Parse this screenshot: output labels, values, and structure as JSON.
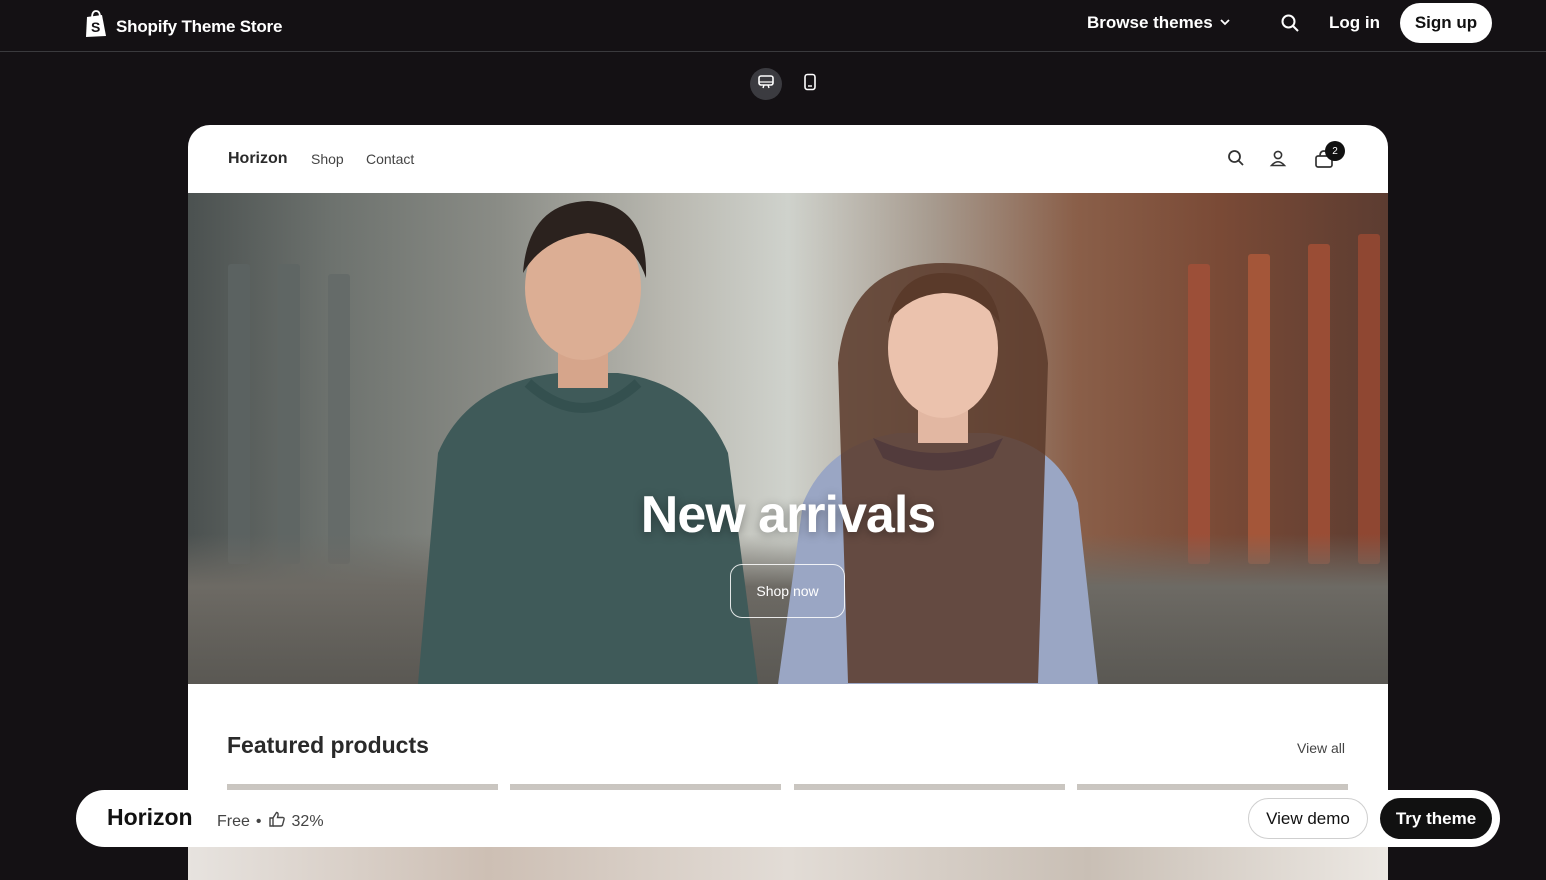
{
  "topbar": {
    "brand_title": "Shopify Theme Store",
    "browse_label": "Browse themes",
    "login_label": "Log in",
    "signup_label": "Sign up"
  },
  "preview": {
    "store": {
      "logo": "Horizon",
      "nav": [
        "Shop",
        "Contact"
      ],
      "cart_count": "2"
    },
    "hero": {
      "title": "New arrivals",
      "button_label": "Shop now"
    },
    "featured": {
      "title": "Featured products",
      "view_all_label": "View all"
    }
  },
  "bottombar": {
    "theme_name": "Horizon",
    "price": "Free",
    "separator": "•",
    "rating": "32%",
    "view_demo_label": "View demo",
    "try_theme_label": "Try theme"
  },
  "colors": {
    "page_bg": "#141114",
    "accent_dark": "#111111",
    "white": "#ffffff"
  },
  "icons": [
    "shopify-bag-icon",
    "chevron-down-icon",
    "search-icon",
    "desktop-icon",
    "mobile-icon",
    "user-icon",
    "cart-icon",
    "thumbs-up-icon"
  ]
}
